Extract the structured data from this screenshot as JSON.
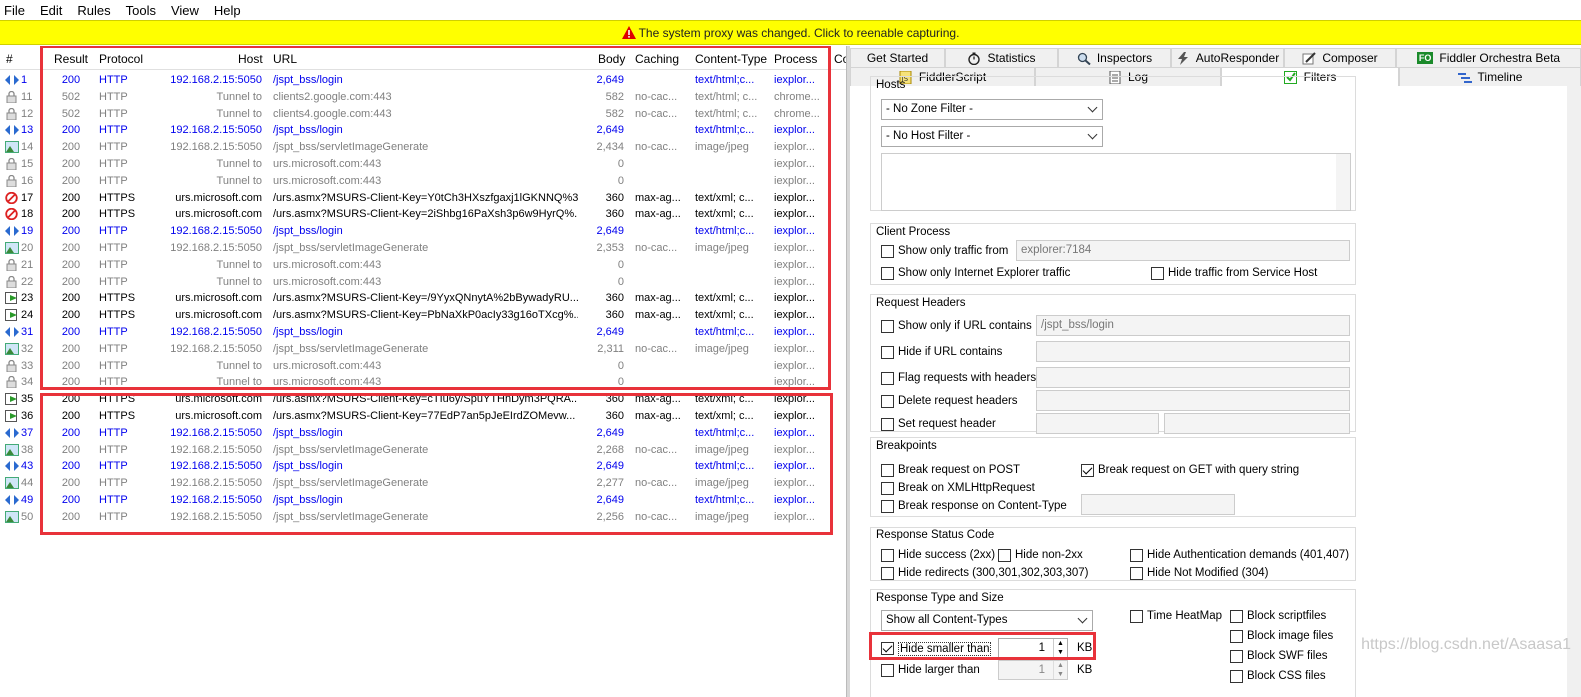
{
  "menu": [
    "File",
    "Edit",
    "Rules",
    "Tools",
    "View",
    "Help"
  ],
  "banner": "The system proxy was changed. Click to reenable capturing.",
  "columns": {
    "num": "#",
    "result": "Result",
    "protocol": "Protocol",
    "host": "Host",
    "url": "URL",
    "body": "Body",
    "caching": "Caching",
    "content_type": "Content-Type",
    "process": "Process",
    "comments": "Co"
  },
  "sessions": [
    {
      "num": "1",
      "result": "200",
      "protocol": "HTTP",
      "host": "192.168.2.15:5050",
      "url": "/jspt_bss/login",
      "body": "2,649",
      "caching": "",
      "ct": "text/html;c...",
      "proc": "iexplor...",
      "style": "blue",
      "icon": "arrows"
    },
    {
      "num": "11",
      "result": "502",
      "protocol": "HTTP",
      "host": "Tunnel to",
      "url": "clients2.google.com:443",
      "body": "582",
      "caching": "no-cac...",
      "ct": "text/html; c...",
      "proc": "chrome...",
      "style": "gray",
      "icon": "lock"
    },
    {
      "num": "12",
      "result": "502",
      "protocol": "HTTP",
      "host": "Tunnel to",
      "url": "clients4.google.com:443",
      "body": "582",
      "caching": "no-cac...",
      "ct": "text/html; c...",
      "proc": "chrome...",
      "style": "gray",
      "icon": "lock"
    },
    {
      "num": "13",
      "result": "200",
      "protocol": "HTTP",
      "host": "192.168.2.15:5050",
      "url": "/jspt_bss/login",
      "body": "2,649",
      "caching": "",
      "ct": "text/html;c...",
      "proc": "iexplor...",
      "style": "blue",
      "icon": "arrows"
    },
    {
      "num": "14",
      "result": "200",
      "protocol": "HTTP",
      "host": "192.168.2.15:5050",
      "url": "/jspt_bss/servletImageGenerate",
      "body": "2,434",
      "caching": "no-cac...",
      "ct": "image/jpeg",
      "proc": "iexplor...",
      "style": "gray",
      "icon": "image"
    },
    {
      "num": "15",
      "result": "200",
      "protocol": "HTTP",
      "host": "Tunnel to",
      "url": "urs.microsoft.com:443",
      "body": "0",
      "caching": "",
      "ct": "",
      "proc": "iexplor...",
      "style": "gray",
      "icon": "lock"
    },
    {
      "num": "16",
      "result": "200",
      "protocol": "HTTP",
      "host": "Tunnel to",
      "url": "urs.microsoft.com:443",
      "body": "0",
      "caching": "",
      "ct": "",
      "proc": "iexplor...",
      "style": "gray",
      "icon": "lock"
    },
    {
      "num": "17",
      "result": "200",
      "protocol": "HTTPS",
      "host": "urs.microsoft.com",
      "url": "/urs.asmx?MSURS-Client-Key=Y0tCh3HXszfgaxj1lGKNNQ%3...",
      "body": "360",
      "caching": "max-ag...",
      "ct": "text/xml; c...",
      "proc": "iexplor...",
      "style": "black",
      "icon": "blocked"
    },
    {
      "num": "18",
      "result": "200",
      "protocol": "HTTPS",
      "host": "urs.microsoft.com",
      "url": "/urs.asmx?MSURS-Client-Key=2iShbg16PaXsh3p6w9HyrQ%...",
      "body": "360",
      "caching": "max-ag...",
      "ct": "text/xml; c...",
      "proc": "iexplor...",
      "style": "black",
      "icon": "blocked"
    },
    {
      "num": "19",
      "result": "200",
      "protocol": "HTTP",
      "host": "192.168.2.15:5050",
      "url": "/jspt_bss/login",
      "body": "2,649",
      "caching": "",
      "ct": "text/html;c...",
      "proc": "iexplor...",
      "style": "blue",
      "icon": "arrows"
    },
    {
      "num": "20",
      "result": "200",
      "protocol": "HTTP",
      "host": "192.168.2.15:5050",
      "url": "/jspt_bss/servletImageGenerate",
      "body": "2,353",
      "caching": "no-cac...",
      "ct": "image/jpeg",
      "proc": "iexplor...",
      "style": "gray",
      "icon": "image"
    },
    {
      "num": "21",
      "result": "200",
      "protocol": "HTTP",
      "host": "Tunnel to",
      "url": "urs.microsoft.com:443",
      "body": "0",
      "caching": "",
      "ct": "",
      "proc": "iexplor...",
      "style": "gray",
      "icon": "lock"
    },
    {
      "num": "22",
      "result": "200",
      "protocol": "HTTP",
      "host": "Tunnel to",
      "url": "urs.microsoft.com:443",
      "body": "0",
      "caching": "",
      "ct": "",
      "proc": "iexplor...",
      "style": "gray",
      "icon": "lock"
    },
    {
      "num": "23",
      "result": "200",
      "protocol": "HTTPS",
      "host": "urs.microsoft.com",
      "url": "/urs.asmx?MSURS-Client-Key=/9YyxQNnytA%2bBywadyRU...",
      "body": "360",
      "caching": "max-ag...",
      "ct": "text/xml; c...",
      "proc": "iexplor...",
      "style": "black",
      "icon": "go"
    },
    {
      "num": "24",
      "result": "200",
      "protocol": "HTTPS",
      "host": "urs.microsoft.com",
      "url": "/urs.asmx?MSURS-Client-Key=PbNaXkP0acIy33g16oTXcg%...",
      "body": "360",
      "caching": "max-ag...",
      "ct": "text/xml; c...",
      "proc": "iexplor...",
      "style": "black",
      "icon": "go"
    },
    {
      "num": "31",
      "result": "200",
      "protocol": "HTTP",
      "host": "192.168.2.15:5050",
      "url": "/jspt_bss/login",
      "body": "2,649",
      "caching": "",
      "ct": "text/html;c...",
      "proc": "iexplor...",
      "style": "blue",
      "icon": "arrows"
    },
    {
      "num": "32",
      "result": "200",
      "protocol": "HTTP",
      "host": "192.168.2.15:5050",
      "url": "/jspt_bss/servletImageGenerate",
      "body": "2,311",
      "caching": "no-cac...",
      "ct": "image/jpeg",
      "proc": "iexplor...",
      "style": "gray",
      "icon": "image"
    },
    {
      "num": "33",
      "result": "200",
      "protocol": "HTTP",
      "host": "Tunnel to",
      "url": "urs.microsoft.com:443",
      "body": "0",
      "caching": "",
      "ct": "",
      "proc": "iexplor...",
      "style": "gray",
      "icon": "lock"
    },
    {
      "num": "34",
      "result": "200",
      "protocol": "HTTP",
      "host": "Tunnel to",
      "url": "urs.microsoft.com:443",
      "body": "0",
      "caching": "",
      "ct": "",
      "proc": "iexplor...",
      "style": "gray",
      "icon": "lock"
    },
    {
      "num": "35",
      "result": "200",
      "protocol": "HTTPS",
      "host": "urs.microsoft.com",
      "url": "/urs.asmx?MSURS-Client-Key=cTIu6y/SpuYTHnDym3PQRA...",
      "body": "360",
      "caching": "max-ag...",
      "ct": "text/xml; c...",
      "proc": "iexplor...",
      "style": "black",
      "icon": "go"
    },
    {
      "num": "36",
      "result": "200",
      "protocol": "HTTPS",
      "host": "urs.microsoft.com",
      "url": "/urs.asmx?MSURS-Client-Key=77EdP7an5pJeEIrdZOMevw...",
      "body": "360",
      "caching": "max-ag...",
      "ct": "text/xml; c...",
      "proc": "iexplor...",
      "style": "black",
      "icon": "go"
    },
    {
      "num": "37",
      "result": "200",
      "protocol": "HTTP",
      "host": "192.168.2.15:5050",
      "url": "/jspt_bss/login",
      "body": "2,649",
      "caching": "",
      "ct": "text/html;c...",
      "proc": "iexplor...",
      "style": "blue",
      "icon": "arrows"
    },
    {
      "num": "38",
      "result": "200",
      "protocol": "HTTP",
      "host": "192.168.2.15:5050",
      "url": "/jspt_bss/servletImageGenerate",
      "body": "2,268",
      "caching": "no-cac...",
      "ct": "image/jpeg",
      "proc": "iexplor...",
      "style": "gray",
      "icon": "image"
    },
    {
      "num": "43",
      "result": "200",
      "protocol": "HTTP",
      "host": "192.168.2.15:5050",
      "url": "/jspt_bss/login",
      "body": "2,649",
      "caching": "",
      "ct": "text/html;c...",
      "proc": "iexplor...",
      "style": "blue",
      "icon": "arrows"
    },
    {
      "num": "44",
      "result": "200",
      "protocol": "HTTP",
      "host": "192.168.2.15:5050",
      "url": "/jspt_bss/servletImageGenerate",
      "body": "2,277",
      "caching": "no-cac...",
      "ct": "image/jpeg",
      "proc": "iexplor...",
      "style": "gray",
      "icon": "image"
    },
    {
      "num": "49",
      "result": "200",
      "protocol": "HTTP",
      "host": "192.168.2.15:5050",
      "url": "/jspt_bss/login",
      "body": "2,649",
      "caching": "",
      "ct": "text/html;c...",
      "proc": "iexplor...",
      "style": "blue",
      "icon": "arrows"
    },
    {
      "num": "50",
      "result": "200",
      "protocol": "HTTP",
      "host": "192.168.2.15:5050",
      "url": "/jspt_bss/servletImageGenerate",
      "body": "2,256",
      "caching": "no-cac...",
      "ct": "image/jpeg",
      "proc": "iexplor...",
      "style": "gray",
      "icon": "image"
    }
  ],
  "tabs_row1": [
    "Get Started",
    "Statistics",
    "Inspectors",
    "AutoResponder",
    "Composer",
    "Fiddler Orchestra Beta"
  ],
  "tabs_row2": [
    "FiddlerScript",
    "Log",
    "Filters",
    "Timeline"
  ],
  "fo_badge": "FO",
  "hosts": {
    "title": "Hosts",
    "zone": "- No Zone Filter -",
    "host": "- No Host Filter -"
  },
  "client": {
    "title": "Client Process",
    "show_only": "Show only traffic from",
    "process_value": "explorer:7184",
    "ie_only": "Show only Internet Explorer traffic",
    "hide_service": "Hide traffic from Service Host"
  },
  "req": {
    "title": "Request Headers",
    "url_contains": "Show only if URL contains",
    "url_value": "/jspt_bss/login",
    "hide_url": "Hide if URL contains",
    "flag": "Flag requests with headers",
    "delete": "Delete request headers",
    "set": "Set request header"
  },
  "bp": {
    "title": "Breakpoints",
    "post": "Break request on POST",
    "get": "Break request on GET with query string",
    "xhr": "Break on XMLHttpRequest",
    "ct": "Break response on Content-Type"
  },
  "status": {
    "title": "Response Status Code",
    "success": "Hide success (2xx)",
    "non2xx": "Hide non-2xx",
    "auth": "Hide Authentication demands (401,407)",
    "redirects": "Hide redirects (300,301,302,303,307)",
    "notmod": "Hide Not Modified (304)"
  },
  "type": {
    "title": "Response Type and Size",
    "select": "Show all Content-Types",
    "heatmap": "Time HeatMap",
    "script": "Block scriptfiles",
    "image": "Block image files",
    "swf": "Block SWF files",
    "css": "Block CSS files",
    "smaller": "Hide smaller than",
    "smaller_val": "1",
    "larger": "Hide larger than",
    "larger_val": "1",
    "kb1": "KB",
    "kb2": "KB"
  },
  "watermark": "https://blog.csdn.net/Asaasa1",
  "colors": {
    "blue": "#0000ee",
    "gray": "#808080",
    "black": "#000000",
    "banner": "#ffff00",
    "redbox": "#e8323a"
  }
}
